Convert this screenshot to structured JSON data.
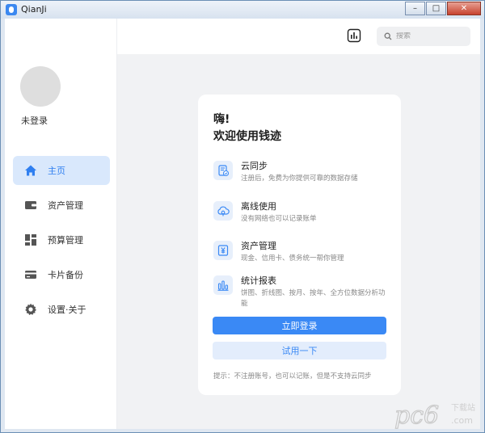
{
  "window": {
    "title": "QianJi",
    "minimize": "–",
    "maximize": "□",
    "close": "✕"
  },
  "sidebar": {
    "login_status": "未登录",
    "items": [
      {
        "label": "主页",
        "icon": "home-icon",
        "active": true
      },
      {
        "label": "资产管理",
        "icon": "wallet-icon",
        "active": false
      },
      {
        "label": "预算管理",
        "icon": "dashboard-icon",
        "active": false
      },
      {
        "label": "卡片备份",
        "icon": "card-icon",
        "active": false
      },
      {
        "label": "设置·关于",
        "icon": "gear-icon",
        "active": false
      }
    ]
  },
  "header": {
    "search_placeholder": "搜索",
    "stats_icon": "bar-chart-icon"
  },
  "welcome": {
    "greeting": "嗨!",
    "title": "欢迎使用钱迹",
    "features": [
      {
        "title": "云同步",
        "desc": "注册后，免费为你提供可靠的数据存储",
        "icon": "cloud-sync-icon"
      },
      {
        "title": "离线使用",
        "desc": "没有网络也可以记录账单",
        "icon": "offline-cloud-icon"
      },
      {
        "title": "资产管理",
        "desc": "现金、信用卡、债务统一帮你管理",
        "icon": "yuan-icon"
      },
      {
        "title": "统计报表",
        "desc": "饼图、折线图、按月、按年、全方位数据分析功能",
        "icon": "chart-icon"
      }
    ],
    "login_button": "立即登录",
    "try_button": "试用一下",
    "hint": "提示：不注册账号，也可以记账，但是不支持云同步"
  },
  "watermark": {
    "main": "pc6",
    "sub1": "下载站",
    "sub2": ".com"
  },
  "colors": {
    "accent": "#3a89f5",
    "active_bg": "#d9e8fc",
    "content_bg": "#f1f2f4"
  }
}
